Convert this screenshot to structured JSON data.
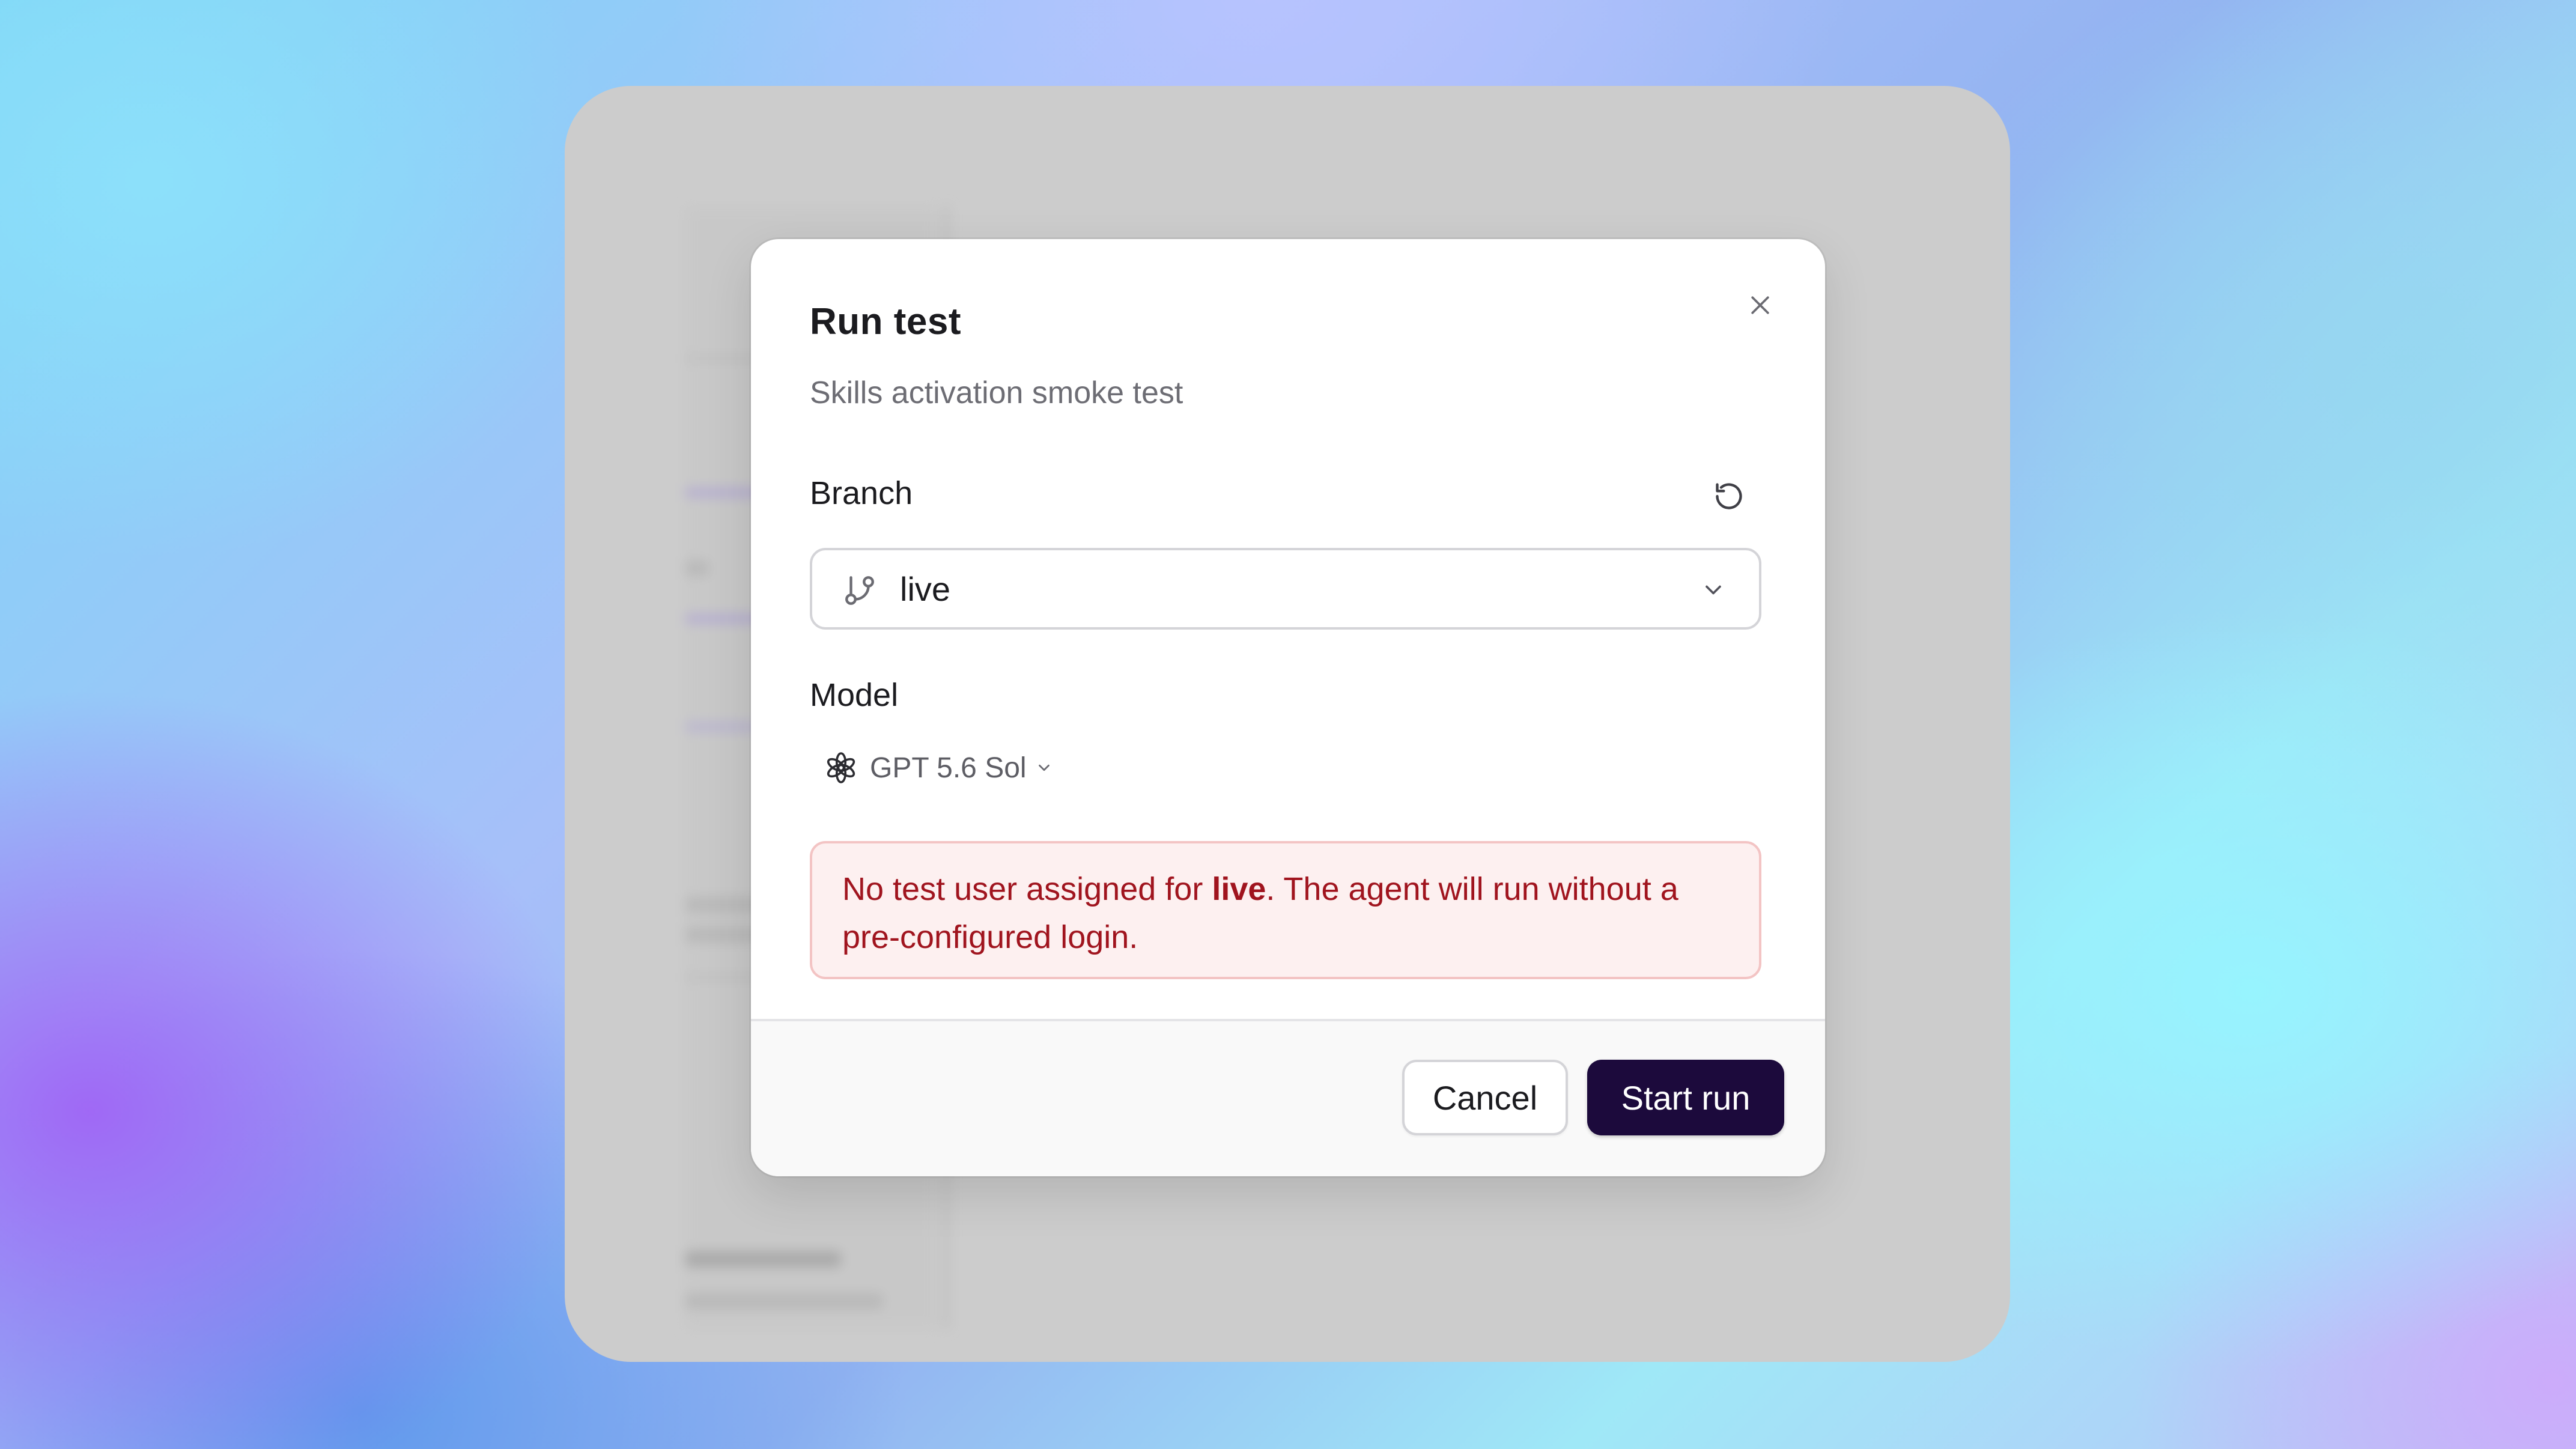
{
  "dialog": {
    "title": "Run test",
    "subtitle": "Skills activation smoke test",
    "close_icon": "close-icon"
  },
  "branch": {
    "label": "Branch",
    "refresh_icon": "refresh-icon",
    "selected": "live",
    "icon": "git-branch-icon",
    "dropdown_icon": "chevron-down-icon"
  },
  "model": {
    "label": "Model",
    "selected": "GPT 5.6 Sol",
    "icon": "openai-logo-icon"
  },
  "alert": {
    "text_before": "No test user assigned for ",
    "branch_name": "live",
    "text_after": ". The agent will run without a pre-configured login.",
    "color": "#a0141e",
    "background": "#fdf0f0"
  },
  "footer": {
    "cancel_label": "Cancel",
    "start_label": "Start run",
    "primary_color": "#1c0a3c"
  }
}
